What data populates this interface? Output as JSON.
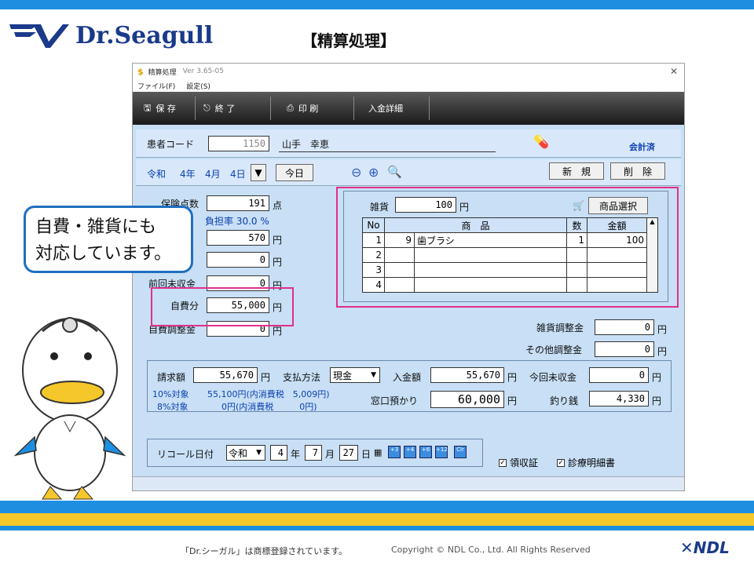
{
  "slide": {
    "title": "【精算処理】",
    "logo": "Dr.Seagull",
    "footer_trademark": "「Dr.シーガル」は商標登録されています。",
    "footer_copyright": "Copyright © NDL Co., Ltd. All Rights Reserved",
    "footer_brand": "NDL",
    "callout_line1": "自費・雑貨にも",
    "callout_line2": "対応しています。"
  },
  "window": {
    "title": "精算処理",
    "version": "Ver 3.65-05",
    "menu": [
      "ファイル(F)",
      "設定(S)"
    ],
    "toolbar": [
      "保 存",
      "終 了",
      "印 刷",
      "入金詳細"
    ]
  },
  "patient": {
    "code_label": "患者コード",
    "code": "1150",
    "name": "山手　幸恵",
    "status": "会計済"
  },
  "date": {
    "era": "令和",
    "year": "4年",
    "month": "4月",
    "day": "4日",
    "today_label": "今日",
    "new_label": "新　規",
    "delete_label": "削　除"
  },
  "left": {
    "insurance_points_label": "保険点数",
    "insurance_points": "191",
    "points_unit": "点",
    "burden_rate": "負担率 30.0 %",
    "amount1": "570",
    "amount2": "0",
    "prev_unpaid_label": "前回未収金",
    "prev_unpaid": "0",
    "self_pay_label": "自費分",
    "self_pay": "55,000",
    "self_adjust_label": "自費調整金",
    "self_adjust": "0",
    "yen": "円"
  },
  "goods": {
    "label": "雑貨",
    "amount": "100",
    "select_label": "商品選択",
    "headers": [
      "No",
      "商　品",
      "数",
      "金額"
    ],
    "rows": [
      {
        "no": "1",
        "code": "9",
        "item": "歯ブラシ",
        "qty": "1",
        "amount": "100"
      },
      {
        "no": "2",
        "code": "",
        "item": "",
        "qty": "",
        "amount": ""
      },
      {
        "no": "3",
        "code": "",
        "item": "",
        "qty": "",
        "amount": ""
      },
      {
        "no": "4",
        "code": "",
        "item": "",
        "qty": "",
        "amount": ""
      }
    ],
    "goods_adjust_label": "雑貨調整金",
    "goods_adjust": "0",
    "other_adjust_label": "その他調整金",
    "other_adjust": "0"
  },
  "billing": {
    "billed_label": "請求額",
    "billed": "55,670",
    "pay_method_label": "支払方法",
    "pay_method": "現金",
    "received_label": "入金額",
    "received": "55,670",
    "this_unpaid_label": "今回未収金",
    "this_unpaid": "0",
    "tax10_label": "10%対象",
    "tax10": "55,100円(内消費税　5,009円)",
    "tax8_label": "8%対象",
    "tax8": "0円(内消費税　　　0円)",
    "deposit_label": "窓口預かり",
    "deposit": "60,000",
    "change_label": "釣り銭",
    "change": "4,330"
  },
  "recall": {
    "label": "リコール日付",
    "era": "令和",
    "year": "4",
    "year_unit": "年",
    "month": "7",
    "month_unit": "月",
    "day": "27",
    "day_unit": "日",
    "quick": [
      "+3",
      "+4",
      "+6",
      "+12",
      "Clr"
    ],
    "receipt_label": "領収証",
    "statement_label": "診療明細書"
  }
}
